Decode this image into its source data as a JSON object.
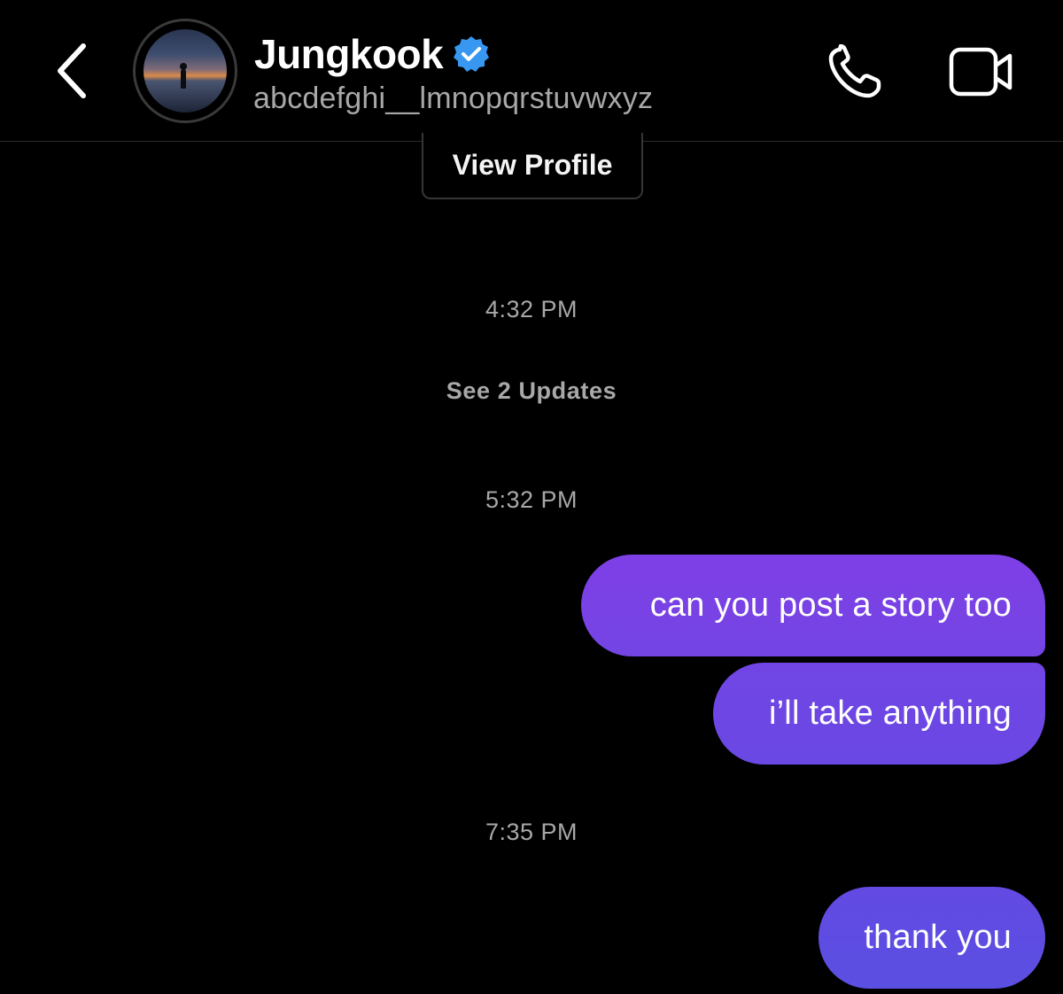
{
  "header": {
    "contact_name": "Jungkook",
    "username": "abcdefghi__lmnopqrstuvwxyz",
    "icons": {
      "back": "chevron-left-icon",
      "verified": "verified-badge-icon",
      "call": "phone-icon",
      "video": "video-camera-icon"
    },
    "verified_color": "#3897f0"
  },
  "profile": {
    "view_profile_label": "View Profile"
  },
  "thread": {
    "timestamp_1": "4:32 PM",
    "see_updates_label": "See 2 Updates",
    "timestamp_2": "5:32 PM",
    "message_1": "can you post a story too",
    "message_2": "i’ll take anything",
    "timestamp_3": "7:35 PM",
    "message_3": "thank you"
  },
  "colors": {
    "background": "#000000",
    "bubble_top": "#7b3fe4",
    "bubble_bottom": "#5b4fe0",
    "secondary_text": "#a8a8a8"
  }
}
